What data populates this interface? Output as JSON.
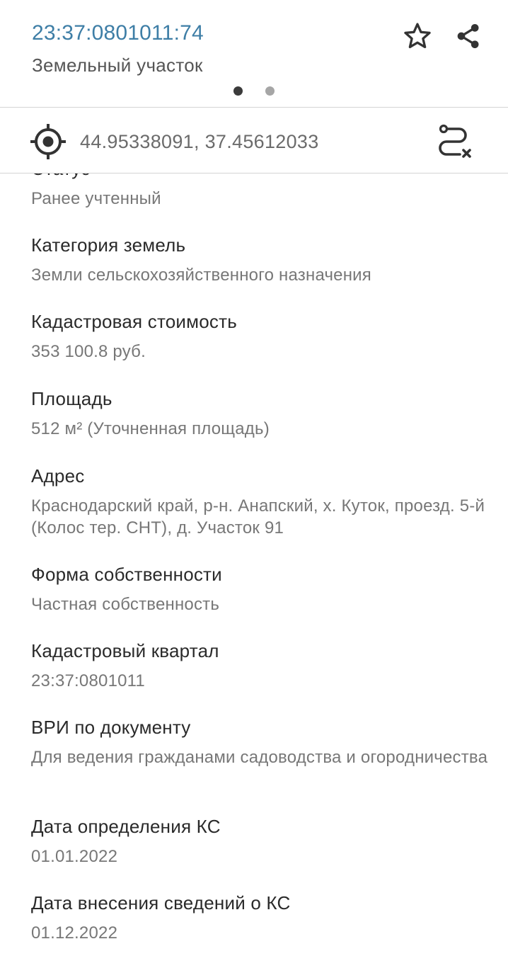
{
  "header": {
    "title": "23:37:0801011:74",
    "subtitle": "Земельный участок",
    "actions": {
      "favorite_icon": "star-outline-icon",
      "share_icon": "share-icon"
    },
    "pager": {
      "pages": 2,
      "active": 1
    }
  },
  "location": {
    "coordinates": "44.95338091, 37.45612033",
    "locate_icon": "crosshair-icon",
    "route_icon": "route-clear-icon"
  },
  "fields": [
    {
      "label": "Статус",
      "value": "Ранее учтенный"
    },
    {
      "label": "Категория земель",
      "value": "Земли сельскохозяйственного назначения"
    },
    {
      "label": "Кадастровая стоимость",
      "value": "353 100.8 руб."
    },
    {
      "label": "Площадь",
      "value": "512 м² (Уточненная площадь)"
    },
    {
      "label": "Адрес",
      "value": "Краснодарский край, р-н. Анапский, х. Куток, проезд. 5-й (Колос тер. СНТ), д. Участок 91"
    },
    {
      "label": "Форма собственности",
      "value": "Частная собственность"
    },
    {
      "label": "Кадастровый квартал",
      "value": "23:37:0801011"
    },
    {
      "label": "ВРИ по документу",
      "value": "Для ведения гражданами садоводства и огородничества"
    },
    {
      "label": "Дата определения КС",
      "value": "01.01.2022"
    },
    {
      "label": "Дата внесения сведений о КС",
      "value": "01.12.2022"
    }
  ],
  "colors": {
    "title": "#3e7ea6",
    "label": "#2a2a2a",
    "value": "#777777",
    "icon": "#333333"
  }
}
